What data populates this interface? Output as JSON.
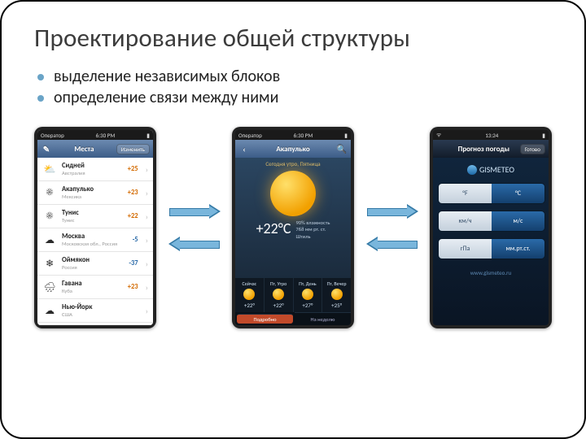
{
  "title": "Проектирование общей структуры",
  "bullets": [
    "выделение независимых блоков",
    "определение связи между ними"
  ],
  "status": {
    "carrier": "Оператор",
    "signal": "ᯤ",
    "time": "6:30 PM",
    "battery": "▮"
  },
  "screen1": {
    "nav": {
      "left": "✎",
      "title": "Места",
      "right": "Изменить"
    },
    "items": [
      {
        "icon": "⛅",
        "city": "Сидней",
        "sub": "Австралия",
        "temp": "+25",
        "neg": false
      },
      {
        "icon": "☀",
        "city": "Акапулько",
        "sub": "Мексика",
        "temp": "+23",
        "neg": false
      },
      {
        "icon": "☀",
        "city": "Тунис",
        "sub": "Тунис",
        "temp": "+22",
        "neg": false
      },
      {
        "icon": "☁",
        "city": "Москва",
        "sub": "Московская обл., Россия",
        "temp": "-5",
        "neg": true
      },
      {
        "icon": "❄",
        "city": "Оймякон",
        "sub": "Россия",
        "temp": "-37",
        "neg": true
      },
      {
        "icon": "🌧",
        "city": "Гавана",
        "sub": "Куба",
        "temp": "+23",
        "neg": false
      },
      {
        "icon": "☁",
        "city": "Нью-Йорк",
        "sub": "США",
        "temp": "",
        "neg": false
      }
    ]
  },
  "screen2": {
    "nav": {
      "left": "‹",
      "title": "Акапулько",
      "right": "🔍"
    },
    "dayLabel": "Сегодня утро, Пятница",
    "temp": "+22°C",
    "meta1": "90% влажность",
    "meta2": "768 мм рт. ст.",
    "meta3": "Штиль",
    "forecast": [
      {
        "d": "Сейчас",
        "t": "+22°"
      },
      {
        "d": "Пт, Утро",
        "t": "+22°"
      },
      {
        "d": "Пт, День",
        "t": "+27°"
      },
      {
        "d": "Пт, Вечер",
        "t": "+25°"
      }
    ],
    "tabs": {
      "left": "Подробно",
      "right": "На неделю"
    }
  },
  "screen3": {
    "statusTime": "13:24",
    "nav": {
      "title": "Прогноз погоды",
      "right": "Готово"
    },
    "brand": "GISMETEO",
    "segments": [
      {
        "a": "°F",
        "b": "°C",
        "selB": true
      },
      {
        "a": "км/ч",
        "b": "м/с",
        "selB": true
      },
      {
        "a": "гПа",
        "b": "мм.рт.ст.",
        "selB": true
      }
    ],
    "site": "www.gismeteo.ru"
  }
}
